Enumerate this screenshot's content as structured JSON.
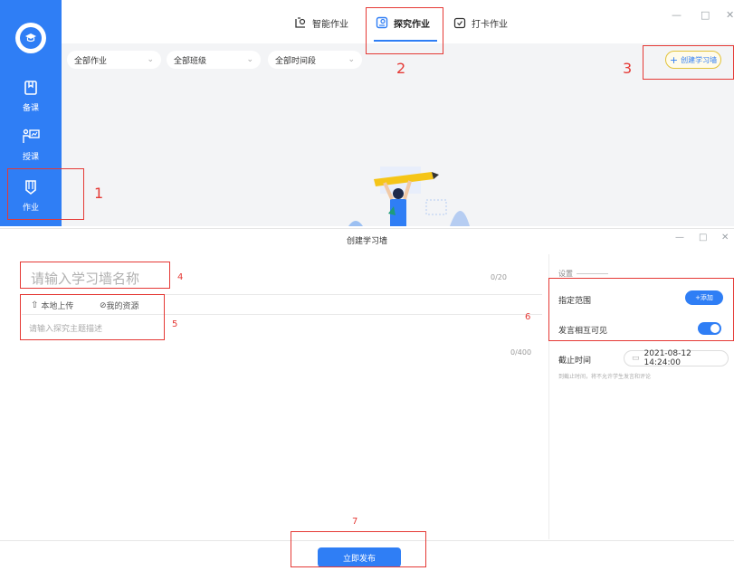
{
  "top_window": {
    "tabs": [
      {
        "label": "智能作业",
        "icon": "smart-homework-icon"
      },
      {
        "label": "探究作业",
        "icon": "explore-homework-icon"
      },
      {
        "label": "打卡作业",
        "icon": "checkin-homework-icon"
      }
    ],
    "active_tab": "探究作业",
    "window_controls": [
      "—",
      "□",
      "✕"
    ],
    "sidebar": {
      "items": [
        {
          "label": "备课",
          "icon": "book-icon"
        },
        {
          "label": "授课",
          "icon": "teach-icon"
        },
        {
          "label": "作业",
          "icon": "pencil-icon"
        }
      ],
      "active_item": "作业"
    },
    "filters": [
      {
        "value": "全部作业"
      },
      {
        "value": "全部班级"
      },
      {
        "value": "全部时间段"
      }
    ],
    "create_button": "创建学习墙"
  },
  "dialog": {
    "title": "创建学习墙",
    "window_controls": [
      "—",
      "□",
      "✕"
    ],
    "name_placeholder": "请输入学习墙名称",
    "name_count": "0/20",
    "upload_local": "本地上传",
    "my_resources": "我的资源",
    "description_placeholder": "请输入探究主题描述",
    "description_count": "0/400",
    "settings": {
      "title": "设置",
      "scope_label": "指定范围",
      "add_button": "+添加",
      "visible_label": "发言相互可见",
      "visible_on": true,
      "deadline_label": "截止时间",
      "deadline_value": "2021-08-12 14:24:00",
      "deadline_note": "到截止时间，将不允许学生发言和评论"
    },
    "publish_button": "立即发布"
  },
  "annotations": [
    "1",
    "2",
    "3",
    "4",
    "5",
    "6",
    "7"
  ],
  "colors": {
    "accent": "#2f7ef5",
    "annotation": "#e53935"
  }
}
